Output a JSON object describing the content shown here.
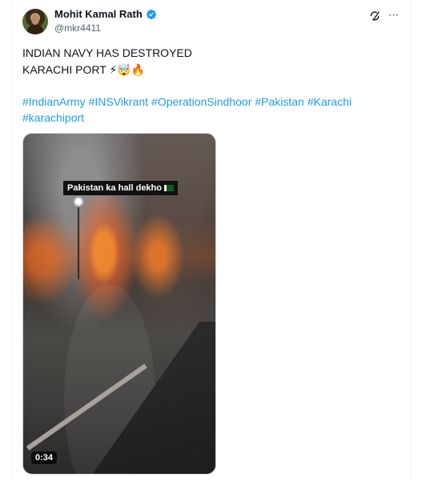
{
  "author": {
    "display_name": "Mohit Kamal Rath",
    "handle": "@mkr4411"
  },
  "post": {
    "line1": "INDIAN NAVY HAS DESTROYED",
    "line2": "KARACHI PORT",
    "line2_emojis": "⚡🤯🔥",
    "hashtags": [
      "#IndianArmy",
      "#INSVikrant",
      "#OperationSindhoor",
      "#Pakistan",
      "#Karachi",
      "#karachiport"
    ]
  },
  "media": {
    "caption": "Pakistan ka hall dekho",
    "duration": "0:34"
  },
  "colors": {
    "link": "#1d9bf0",
    "verified": "#1d9bf0",
    "text": "#0f1419",
    "secondary": "#536471"
  },
  "icons": [
    "verified-badge-icon",
    "grok-icon",
    "more-icon",
    "pakistan-flag-icon"
  ]
}
